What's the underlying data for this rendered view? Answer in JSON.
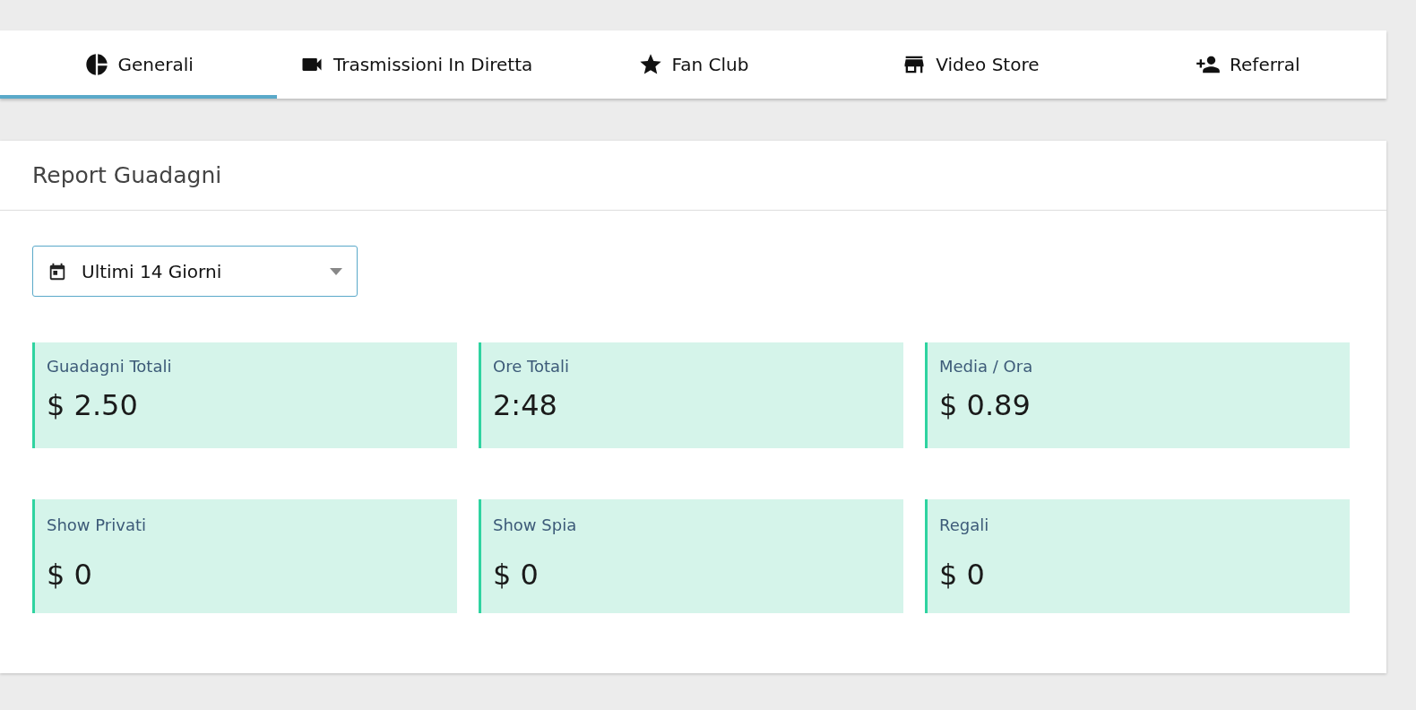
{
  "tabs": [
    {
      "label": "Generali",
      "kind": "pie",
      "selected": true
    },
    {
      "label": "Trasmissioni In Diretta",
      "kind": "camera",
      "selected": false
    },
    {
      "label": "Fan Club",
      "kind": "star",
      "selected": false
    },
    {
      "label": "Video Store",
      "kind": "store",
      "selected": false
    },
    {
      "label": "Referral",
      "kind": "person-add",
      "selected": false
    }
  ],
  "report": {
    "title": "Report Guadagni",
    "period": {
      "value": "Ultimi 14 Giorni"
    },
    "stats": [
      {
        "label": "Guadagni Totali",
        "value": "$ 2.50"
      },
      {
        "label": "Ore Totali",
        "value": "2:48"
      },
      {
        "label": "Media / Ora",
        "value": "$ 0.89"
      },
      {
        "label": "Show Privati",
        "value": "$ 0"
      },
      {
        "label": "Show Spia",
        "value": "$ 0"
      },
      {
        "label": "Regali",
        "value": "$ 0"
      }
    ]
  }
}
